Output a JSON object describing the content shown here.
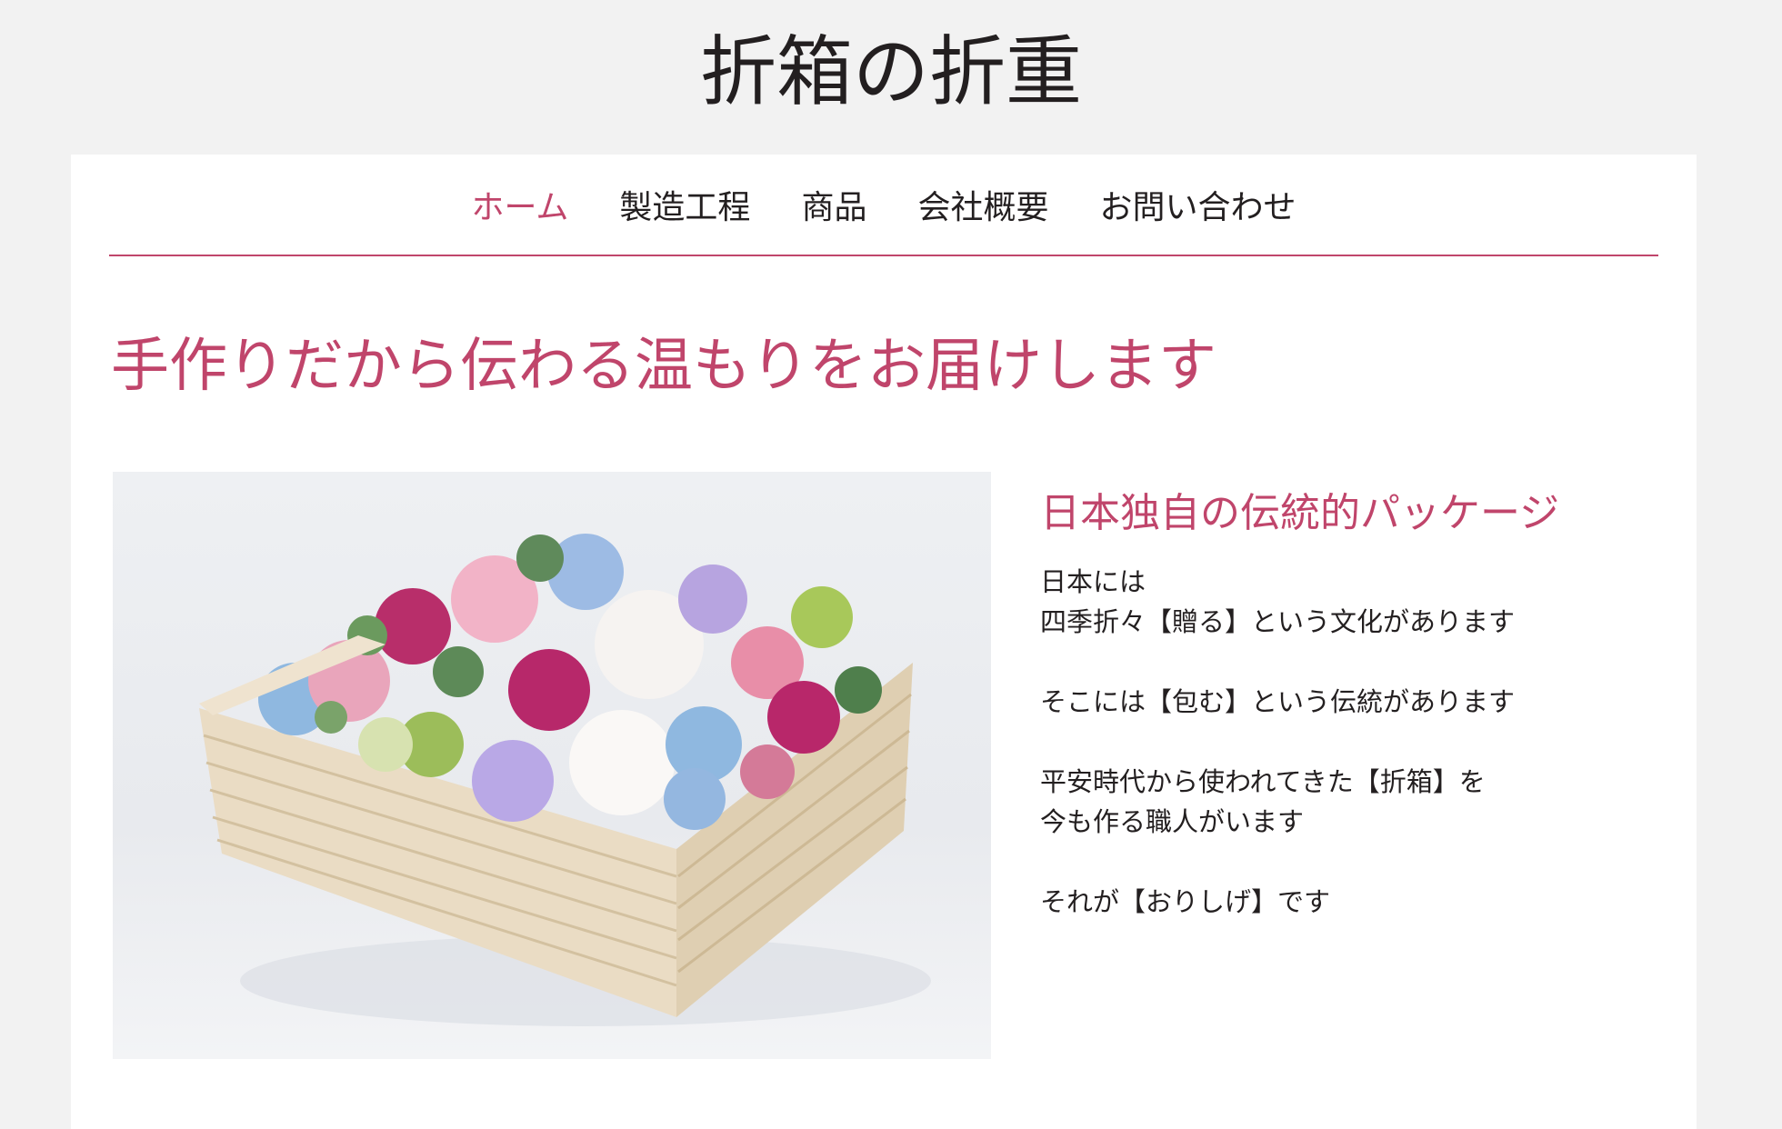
{
  "site": {
    "title": "折箱の折重"
  },
  "nav": {
    "items": [
      {
        "label": "ホーム",
        "active": true
      },
      {
        "label": "製造工程",
        "active": false
      },
      {
        "label": "商品",
        "active": false
      },
      {
        "label": "会社概要",
        "active": false
      },
      {
        "label": "お問い合わせ",
        "active": false
      }
    ]
  },
  "hero": {
    "heading": "手作りだから伝わる温もりをお届けします"
  },
  "intro": {
    "heading": "日本独自の伝統的パッケージ",
    "lines": [
      "日本には",
      "四季折々【贈る】という文化があります",
      "",
      "そこには【包む】という伝統があります",
      "",
      "平安時代から使われてきた【折箱】を",
      "今も作る職人がいます",
      "",
      "それが【おりしげ】です"
    ]
  },
  "colors": {
    "accent": "#c0456b",
    "text": "#231f20",
    "page_background": "#f2f2f2",
    "card_background": "#ffffff"
  },
  "image": {
    "subject": "flower-arrangement-in-wooden-box"
  }
}
